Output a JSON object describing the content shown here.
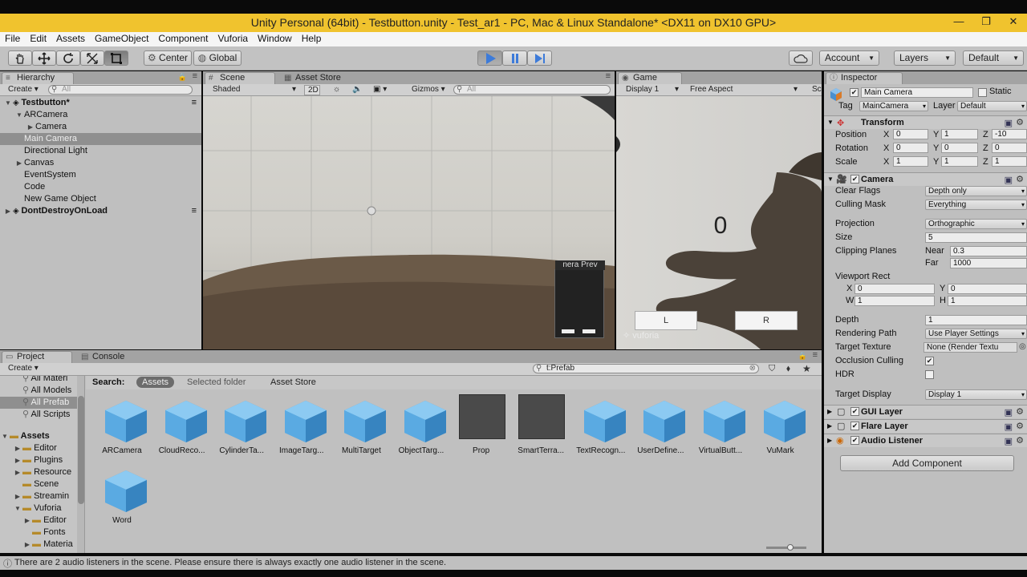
{
  "window": {
    "title": "Unity Personal (64bit) - Testbutton.unity - Test_ar1 - PC, Mac & Linux Standalone* <DX11 on DX10 GPU>",
    "controls": [
      "—",
      "❐",
      "✕"
    ]
  },
  "menu": [
    "File",
    "Edit",
    "Assets",
    "GameObject",
    "Component",
    "Vuforia",
    "Window",
    "Help"
  ],
  "toolbar": {
    "pivot": "Center",
    "space": "Global",
    "account": "Account",
    "layers": "Layers",
    "layout": "Default"
  },
  "hierarchy": {
    "tab": "Hierarchy",
    "create": "Create",
    "search_placeholder": "All",
    "items": [
      {
        "label": "Testbutton*",
        "arrow": "▼",
        "scene": true
      },
      {
        "label": "ARCamera",
        "arrow": "▼"
      },
      {
        "label": "Camera",
        "arrow": "▶"
      },
      {
        "label": "Main Camera",
        "arrow": ""
      },
      {
        "label": "Directional Light",
        "arrow": ""
      },
      {
        "label": "Canvas",
        "arrow": "▶"
      },
      {
        "label": "EventSystem",
        "arrow": ""
      },
      {
        "label": "Code",
        "arrow": ""
      },
      {
        "label": "New Game Object",
        "arrow": ""
      },
      {
        "label": "DontDestroyOnLoad",
        "arrow": "▶",
        "scene": true
      }
    ]
  },
  "scene": {
    "tab": "Scene",
    "tab2": "Asset Store",
    "shading": "Shaded",
    "mode2d": "2D",
    "gizmos": "Gizmos",
    "search_placeholder": "All",
    "preview_label": "nera Prev"
  },
  "game": {
    "tab": "Game",
    "display": "Display 1",
    "aspect": "Free Aspect",
    "scale_label": "Sc",
    "counter": "0",
    "left_button": "L",
    "right_button": "R",
    "watermark": "vuforia"
  },
  "inspector": {
    "tab": "Inspector",
    "object_name": "Main Camera",
    "static_label": "Static",
    "tag_label": "Tag",
    "tag_value": "MainCamera",
    "layer_label": "Layer",
    "layer_value": "Default",
    "transform": {
      "title": "Transform",
      "position_label": "Position",
      "rotation_label": "Rotation",
      "scale_label": "Scale",
      "position": {
        "x": "0",
        "y": "1",
        "z": "-10"
      },
      "rotation": {
        "x": "0",
        "y": "0",
        "z": "0"
      },
      "scale": {
        "x": "1",
        "y": "1",
        "z": "1"
      }
    },
    "camera": {
      "title": "Camera",
      "clear_flags_label": "Clear Flags",
      "clear_flags": "Depth only",
      "culling_mask_label": "Culling Mask",
      "culling_mask": "Everything",
      "projection_label": "Projection",
      "projection": "Orthographic",
      "size_label": "Size",
      "size": "5",
      "clipping_label": "Clipping Planes",
      "near_label": "Near",
      "near": "0.3",
      "far_label": "Far",
      "far": "1000",
      "viewport_label": "Viewport Rect",
      "vx": "0",
      "vy": "0",
      "vw": "1",
      "vh": "1",
      "depth_label": "Depth",
      "depth": "1",
      "rendering_path_label": "Rendering Path",
      "rendering_path": "Use Player Settings",
      "target_texture_label": "Target Texture",
      "target_texture": "None (Render Textu",
      "occlusion_label": "Occlusion Culling",
      "hdr_label": "HDR",
      "target_display_label": "Target Display",
      "target_display": "Display 1"
    },
    "components": [
      "GUI Layer",
      "Flare Layer",
      "Audio Listener"
    ],
    "add_component": "Add Component"
  },
  "project": {
    "tab": "Project",
    "tab2": "Console",
    "create": "Create",
    "search_value": "t:Prefab",
    "search_label": "Search:",
    "scope_assets": "Assets",
    "scope_selected": "Selected folder",
    "scope_store": "Asset Store",
    "favorites": [
      "All Materi",
      "All Models",
      "All Prefab",
      "All Scripts"
    ],
    "tree_root": "Assets",
    "tree": [
      {
        "label": "Editor",
        "indent": 1,
        "arrow": "▶"
      },
      {
        "label": "Plugins",
        "indent": 1,
        "arrow": "▶"
      },
      {
        "label": "Resource",
        "indent": 1,
        "arrow": "▶"
      },
      {
        "label": "Scene",
        "indent": 1,
        "arrow": ""
      },
      {
        "label": "Streamin",
        "indent": 1,
        "arrow": "▶"
      },
      {
        "label": "Vuforia",
        "indent": 1,
        "arrow": "▼"
      },
      {
        "label": "Editor",
        "indent": 2,
        "arrow": "▶"
      },
      {
        "label": "Fonts",
        "indent": 2,
        "arrow": ""
      },
      {
        "label": "Materia",
        "indent": 2,
        "arrow": "▶"
      }
    ],
    "assets": [
      {
        "label": "ARCamera",
        "kind": "cube"
      },
      {
        "label": "CloudReco...",
        "kind": "cube"
      },
      {
        "label": "CylinderTa...",
        "kind": "cube"
      },
      {
        "label": "ImageTarg...",
        "kind": "cube"
      },
      {
        "label": "MultiTarget",
        "kind": "cube"
      },
      {
        "label": "ObjectTarg...",
        "kind": "cube"
      },
      {
        "label": "Prop",
        "kind": "dark"
      },
      {
        "label": "SmartTerra...",
        "kind": "dark"
      },
      {
        "label": "TextRecogn...",
        "kind": "cube"
      },
      {
        "label": "UserDefine...",
        "kind": "cube"
      },
      {
        "label": "VirtualButt...",
        "kind": "cube"
      },
      {
        "label": "VuMark",
        "kind": "cube"
      },
      {
        "label": "Word",
        "kind": "cube"
      }
    ]
  },
  "status": {
    "message": "There are 2 audio listeners in the scene. Please ensure there is always exactly one audio listener in the scene."
  },
  "colors": {
    "titlebar": "#f0c32e",
    "play_active": "#3d7bd9",
    "selection": "#8f8f8f"
  }
}
